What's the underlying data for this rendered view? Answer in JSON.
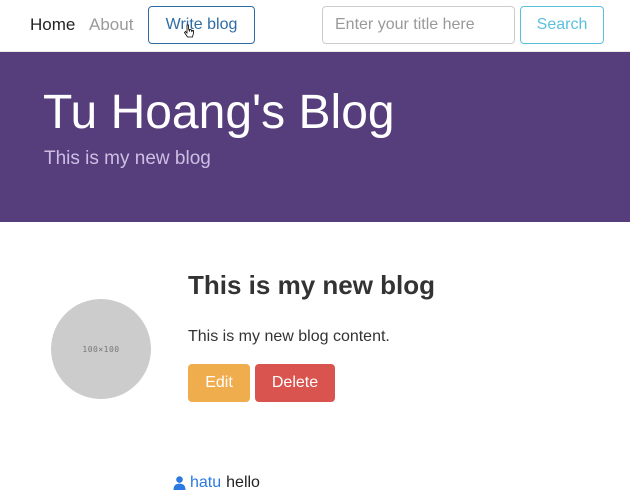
{
  "nav": {
    "home_label": "Home",
    "about_label": "About",
    "write_label": "Write blog",
    "search_placeholder": "Enter your title here",
    "search_value": "",
    "search_label": "Search"
  },
  "header": {
    "title": "Tu Hoang's Blog",
    "subtitle": "This is my new blog"
  },
  "post": {
    "avatar_text": "100×100",
    "title": "This is my new blog",
    "content": "This is my new blog content.",
    "edit_label": "Edit",
    "delete_label": "Delete"
  },
  "comments": [
    {
      "user": "hatu",
      "text": "hello",
      "icon": "user-icon"
    }
  ],
  "colors": {
    "header_bg": "#563d7c",
    "edit": "#f0ad4e",
    "delete": "#d9534f",
    "search": "#5bc0de",
    "write": "#2e6da4"
  }
}
